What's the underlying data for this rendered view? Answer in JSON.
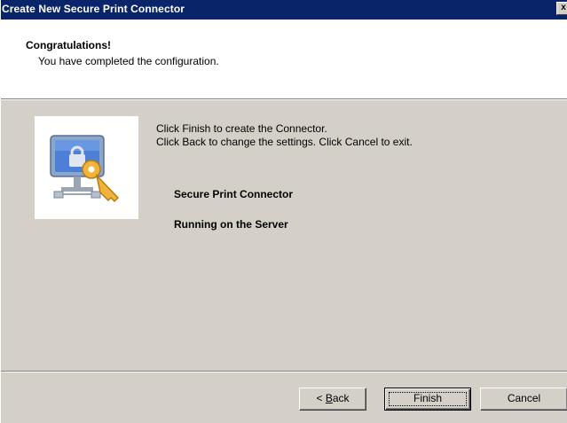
{
  "window": {
    "title": "Create New Secure Print Connector",
    "close_glyph": "x"
  },
  "header": {
    "title": "Congratulations!",
    "subtitle": "You have completed the configuration."
  },
  "body": {
    "instruction_1": "Click Finish to create the Connector.",
    "instruction_2": "Click Back to change the settings. Click Cancel to exit.",
    "connector_name": "Secure Print Connector",
    "location": "Running on the Server",
    "image_icon": "computer-key-icon"
  },
  "buttons": {
    "back_prefix": "< ",
    "back_accel": "B",
    "back_rest": "ack",
    "finish": "Finish",
    "cancel": "Cancel"
  },
  "colors": {
    "titlebar": "#0a246a",
    "dialog_bg": "#d4d0c8",
    "header_bg": "#ffffff"
  }
}
